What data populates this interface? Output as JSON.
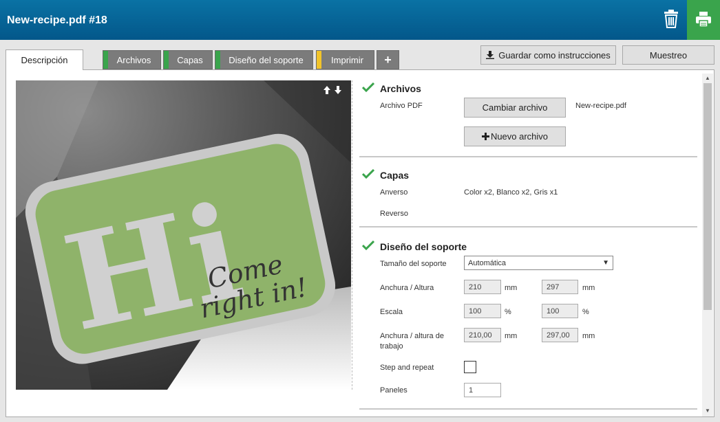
{
  "header": {
    "title": "New-recipe.pdf #18",
    "trash_icon": "trash-icon",
    "print_icon": "printer-icon",
    "accent": "#3aa44c"
  },
  "tabs": [
    {
      "label": "Descripción",
      "active": true
    },
    {
      "label": "Archivos",
      "stripe": "#3aa44c"
    },
    {
      "label": "Capas",
      "stripe": "#3aa44c"
    },
    {
      "label": "Diseño del soporte",
      "stripe": "#3aa44c"
    },
    {
      "label": "Imprimir",
      "stripe": "#f2c42a"
    },
    {
      "label": "+"
    }
  ],
  "toolbar": {
    "save_instructions": "Guardar como instrucciones",
    "sampling": "Muestreo"
  },
  "preview": {
    "hi_text": "Hi",
    "tagline_1": "Come",
    "tagline_2": "right in!"
  },
  "archivos": {
    "title": "Archivos",
    "pdf_label": "Archivo PDF",
    "change_button": "Cambiar archivo",
    "filename": "New-recipe.pdf",
    "new_button": "Nuevo archivo"
  },
  "capas": {
    "title": "Capas",
    "front_label": "Anverso",
    "front_value": "Color x2, Blanco x2, Gris x1",
    "back_label": "Reverso"
  },
  "diseno": {
    "title": "Diseño del soporte",
    "size_label": "Tamaño del soporte",
    "size_value": "Automática",
    "wh_label": "Anchura / Altura",
    "width": "210",
    "height": "297",
    "unit_mm": "mm",
    "scale_label": "Escala",
    "scale_x": "100",
    "scale_y": "100",
    "unit_pct": "%",
    "work_label_1": "Anchura / altura de",
    "work_label_2": "trabajo",
    "work_width": "210,00",
    "work_height": "297,00",
    "step_label": "Step and repeat",
    "panels_label": "Paneles",
    "panels_value": "1"
  }
}
